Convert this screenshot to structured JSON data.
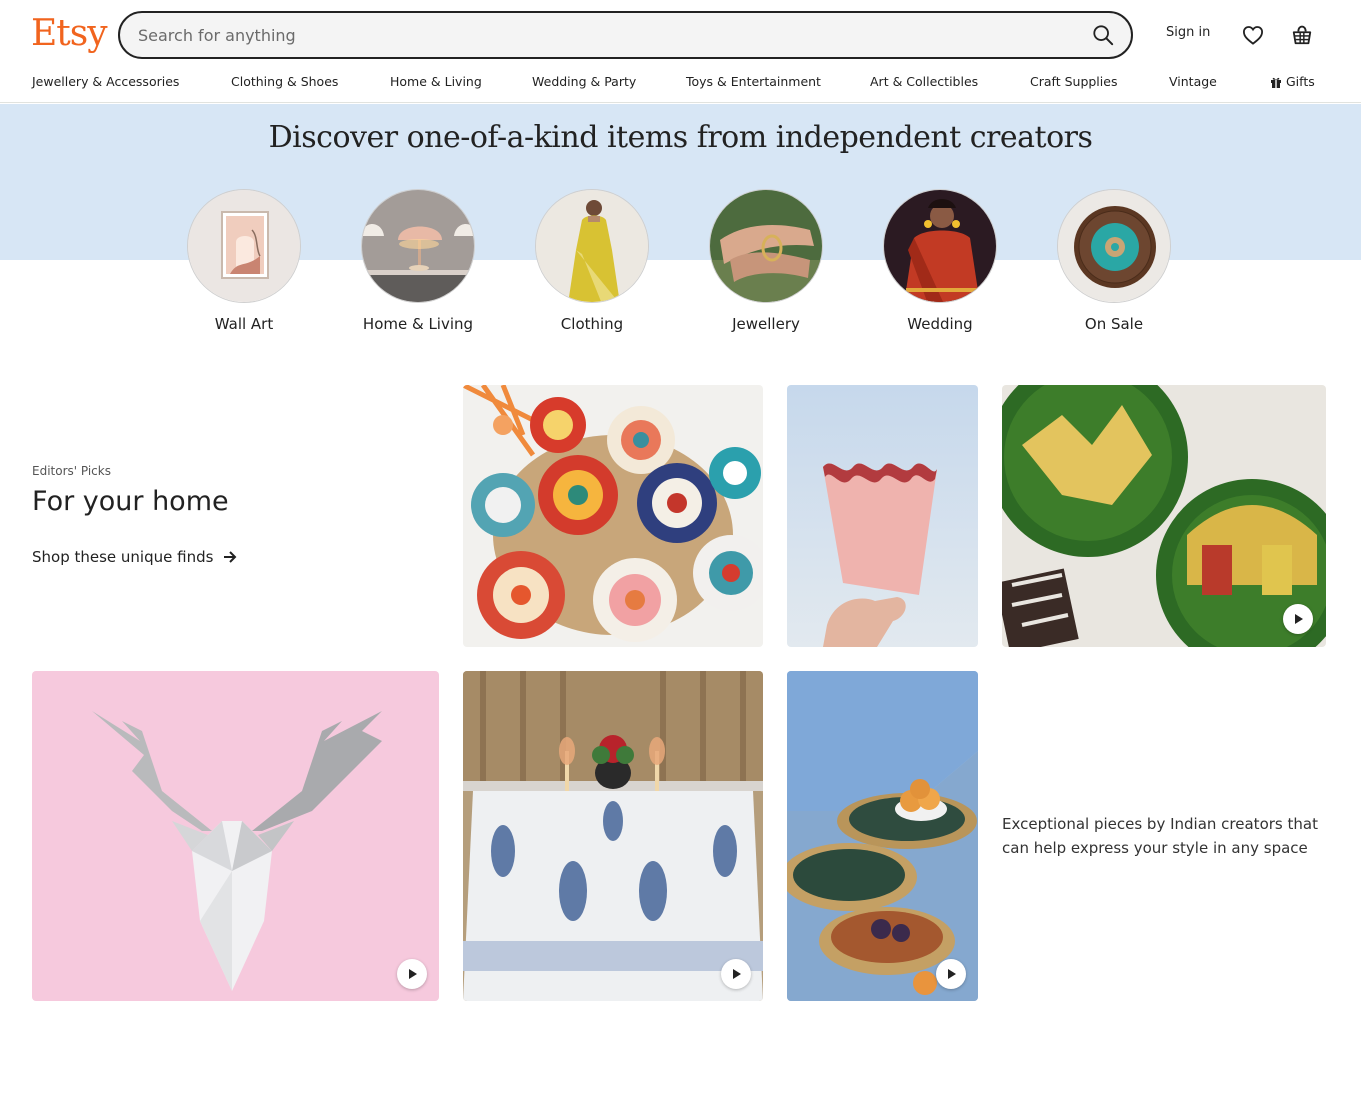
{
  "header": {
    "logo": "Etsy",
    "search_placeholder": "Search for anything",
    "sign_in": "Sign in"
  },
  "nav": [
    "Jewellery & Accessories",
    "Clothing & Shoes",
    "Home & Living",
    "Wedding & Party",
    "Toys & Entertainment",
    "Art & Collectibles",
    "Craft Supplies",
    "Vintage",
    "Gifts"
  ],
  "hero": {
    "title": "Discover one-of-a-kind items from independent creators",
    "categories": [
      "Wall Art",
      "Home & Living",
      "Clothing",
      "Jewellery",
      "Wedding",
      "On Sale"
    ]
  },
  "editors_picks": {
    "kicker": "Editors' Picks",
    "title": "For your home",
    "link": "Shop these unique finds",
    "description": "Exceptional pieces by Indian creators that can help express your style in any space"
  },
  "colors": {
    "brand": "#f1641e",
    "hero_bg": "#d7e6f5"
  }
}
